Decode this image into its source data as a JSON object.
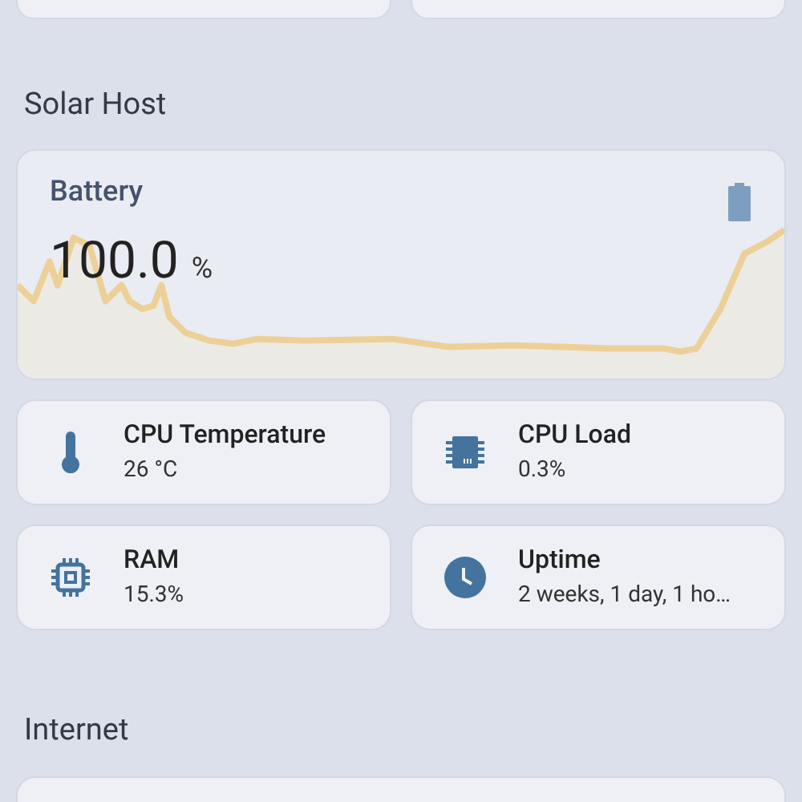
{
  "sections": [
    {
      "title": "Solar Host",
      "battery": {
        "label": "Battery",
        "value": "100.0",
        "unit": "%"
      },
      "tiles": [
        {
          "name": "CPU Temperature",
          "state": "26 °C"
        },
        {
          "name": "CPU Load",
          "state": "0.3%"
        },
        {
          "name": "RAM",
          "state": "15.3%"
        },
        {
          "name": "Uptime",
          "state": "2 weeks, 1 day, 1 ho…"
        }
      ]
    },
    {
      "title": "Internet"
    }
  ]
}
